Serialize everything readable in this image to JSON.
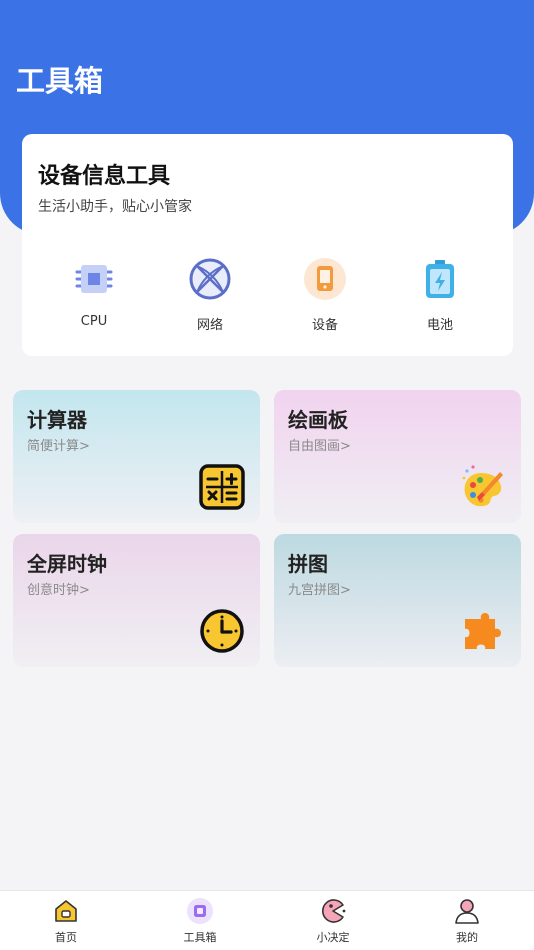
{
  "header": {
    "title": "工具箱"
  },
  "info_card": {
    "title": "设备信息工具",
    "subtitle": "生活小助手，贴心小管家",
    "tools": [
      {
        "label": "CPU",
        "icon": "cpu-icon"
      },
      {
        "label": "网络",
        "icon": "network-icon"
      },
      {
        "label": "设备",
        "icon": "device-icon"
      },
      {
        "label": "电池",
        "icon": "battery-icon"
      }
    ]
  },
  "feature_cards": [
    {
      "title": "计算器",
      "subtitle": "简便计算>",
      "icon": "calculator-icon"
    },
    {
      "title": "绘画板",
      "subtitle": "自由图画>",
      "icon": "palette-icon"
    },
    {
      "title": "全屏时钟",
      "subtitle": "创意时钟>",
      "icon": "clock-icon"
    },
    {
      "title": "拼图",
      "subtitle": "九宫拼图>",
      "icon": "puzzle-icon"
    }
  ],
  "tabbar": {
    "active_color": "#9b6cf0",
    "items": [
      {
        "label": "首页",
        "icon": "home-icon"
      },
      {
        "label": "工具箱",
        "icon": "toolbox-icon"
      },
      {
        "label": "小决定",
        "icon": "decision-icon"
      },
      {
        "label": "我的",
        "icon": "profile-icon"
      }
    ]
  },
  "colors": {
    "brand": "#3b72e6"
  }
}
